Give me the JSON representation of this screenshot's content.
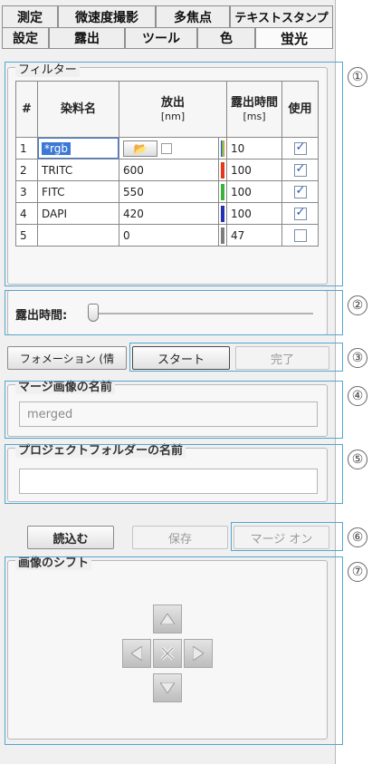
{
  "tabs_row1": [
    "測定",
    "微速度撮影",
    "多焦点",
    "テキストスタンプ"
  ],
  "tabs_row2": [
    "設定",
    "露出",
    "ツール",
    "色",
    "蛍光"
  ],
  "filter": {
    "title": "フィルター",
    "headers": {
      "num": "#",
      "dye": "染料名",
      "emission": "放出",
      "emission_unit": "[nm]",
      "exposure": "露出時間",
      "exposure_unit": "[ms]",
      "use": "使用"
    },
    "rows": [
      {
        "num": "1",
        "dye": "*rgb",
        "emission": "",
        "exposure": "10",
        "use": true,
        "color": "rainbow"
      },
      {
        "num": "2",
        "dye": "TRITC",
        "emission": "600",
        "exposure": "100",
        "use": true,
        "color": "#e8351e"
      },
      {
        "num": "3",
        "dye": "FITC",
        "emission": "550",
        "exposure": "100",
        "use": true,
        "color": "#3bb23a"
      },
      {
        "num": "4",
        "dye": "DAPI",
        "emission": "420",
        "exposure": "100",
        "use": true,
        "color": "#2530b8"
      },
      {
        "num": "5",
        "dye": "",
        "emission": "0",
        "exposure": "47",
        "use": false,
        "color": "#7d7d7d"
      }
    ]
  },
  "exposure_label": "露出時間:",
  "buttons": {
    "info": "フォメーション (情",
    "start": "スタート",
    "done": "完了",
    "load": "読込む",
    "save": "保存",
    "merge_on": "マージ オン"
  },
  "merge_name": {
    "title": "マージ画像の名前",
    "value": "merged"
  },
  "project_folder": {
    "title": "プロジェクトフォルダーの名前",
    "value": ""
  },
  "shift": {
    "title": "画像のシフト"
  },
  "callouts": [
    "①",
    "②",
    "③",
    "④",
    "⑤",
    "⑥",
    "⑦"
  ]
}
